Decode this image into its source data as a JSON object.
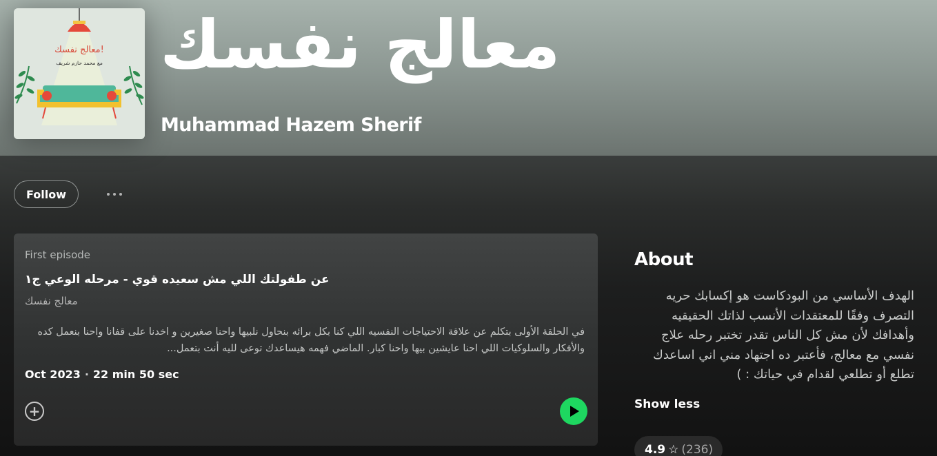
{
  "podcast": {
    "title": "معالج نفسك",
    "author": "Muhammad Hazem Sherif",
    "cover": {
      "title": "معالج نفسك!",
      "subtitle": "مع محمد حازم شريف",
      "colors": {
        "background": "#dfe6df",
        "lamp": "#e5493a",
        "sofa": "#4fb79a",
        "frame": "#f2c12e",
        "leaves": "#2e8b4f"
      }
    }
  },
  "actions": {
    "follow_label": "Follow",
    "more_icon": "more-dots-icon"
  },
  "episode": {
    "kicker": "First episode",
    "title": "عن طفولتك اللي مش سعيده قوي - مرحله الوعي ج١",
    "show": "معالج نفسك",
    "description": "في الحلقة الأولى بتكلم عن علاقة الاحتياجات النفسيه اللي كنا بكل برائه بنحاول نلبيها واحنا صغيرين و اخدنا على قفانا واحنا بنعمل كده والأفكار والسلوكيات اللي احنا عايشين بيها واحنا كبار. الماضي فهمه هيساعدك توعى لليه أنت بتعمل...",
    "date": "Oct 2023",
    "separator": "·",
    "duration": "22 min 50 sec",
    "add_icon": "add-circle-icon",
    "play_icon": "play-icon",
    "accent": "#1ed760"
  },
  "about": {
    "heading": "About",
    "text": "الهدف الأساسي من البودكاست هو إكسابك حريه التصرف وفقًا للمعتقدات الأنسب لذاتك الحقيقيه وأهدافك لأن مش كل الناس تقدر تختبر رحله علاج نفسي مع معالج،  فأعتبر ده اجتهاد مني اني اساعدك تطلع أو تطلعي لقدام في حياتك : )",
    "show_less": "Show less"
  },
  "rating": {
    "value": "4.9",
    "star_icon": "star-outline-icon",
    "count": "(236)"
  }
}
